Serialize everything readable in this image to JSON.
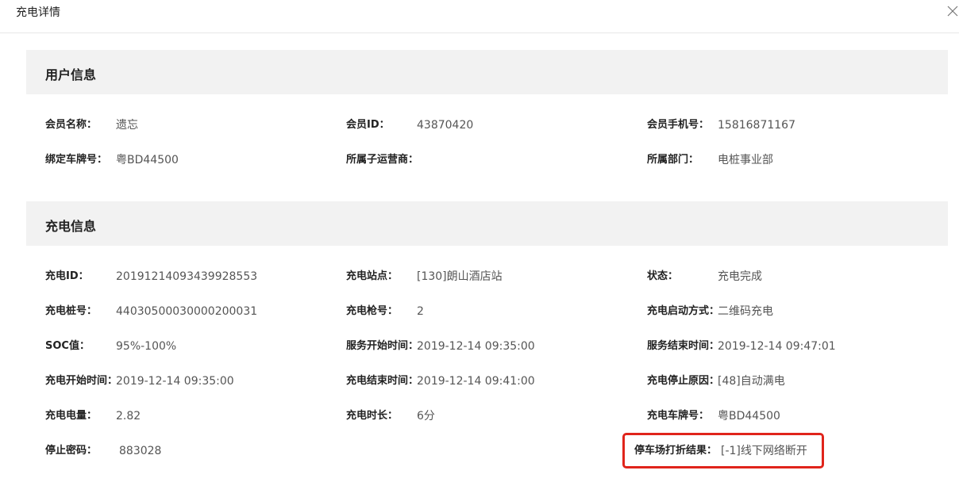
{
  "dialog": {
    "title": "充电详情"
  },
  "user_section": {
    "title": "用户信息",
    "fields": {
      "member_name": {
        "label": "会员名称：",
        "value": "遗忘"
      },
      "member_id": {
        "label": "会员ID：",
        "value": "43870420"
      },
      "member_phone": {
        "label": "会员手机号：",
        "value": "15816871167"
      },
      "bound_plate": {
        "label": "绑定车牌号：",
        "value": "粤BD44500"
      },
      "sub_operator": {
        "label": "所属子运营商：",
        "value": ""
      },
      "department": {
        "label": "所属部门：",
        "value": "电桩事业部"
      }
    }
  },
  "charge_section": {
    "title": "充电信息",
    "fields": {
      "charge_id": {
        "label": "充电ID：",
        "value": "20191214093439928553"
      },
      "station": {
        "label": "充电站点：",
        "value": "[130]朗山酒店站"
      },
      "status": {
        "label": "状态：",
        "value": "充电完成"
      },
      "pile_no": {
        "label": "充电桩号：",
        "value": "44030500030000200031"
      },
      "gun_no": {
        "label": "充电枪号：",
        "value": "2"
      },
      "start_mode": {
        "label": "充电启动方式：",
        "value": "二维码充电"
      },
      "soc": {
        "label": "SOC值：",
        "value": "95%-100%"
      },
      "service_start": {
        "label": "服务开始时间：",
        "value": "2019-12-14 09:35:00"
      },
      "service_end": {
        "label": "服务结束时间：",
        "value": "2019-12-14 09:47:01"
      },
      "charge_start": {
        "label": "充电开始时间：",
        "value": "2019-12-14 09:35:00"
      },
      "charge_end": {
        "label": "充电结束时间：",
        "value": "2019-12-14 09:41:00"
      },
      "stop_reason": {
        "label": "充电停止原因：",
        "value": "[48]自动满电"
      },
      "energy": {
        "label": "充电电量：",
        "value": "2.82"
      },
      "duration": {
        "label": "充电时长：",
        "value": "6分"
      },
      "charge_plate": {
        "label": "充电车牌号：",
        "value": "粤BD44500"
      },
      "stop_password": {
        "label": "停止密码：",
        "value": "883028"
      },
      "parking_discount": {
        "label": "停车场打折结果：",
        "value": "[-1]线下网络断开"
      }
    }
  },
  "colors": {
    "highlight": "#e0241b",
    "section_bg": "#f2f2f2"
  }
}
